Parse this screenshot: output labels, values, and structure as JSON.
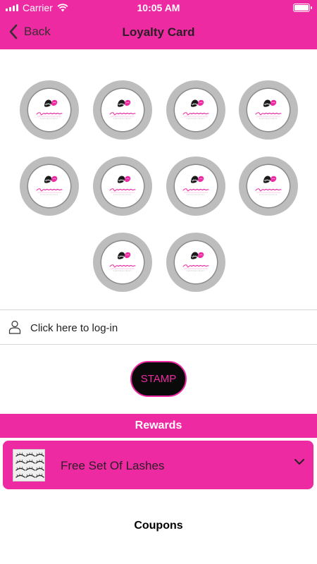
{
  "status_bar": {
    "carrier": "Carrier",
    "time": "10:05 AM"
  },
  "nav": {
    "back_label": "Back",
    "title": "Loyalty Card"
  },
  "stamps": {
    "count": 10,
    "logo_alt": "Pretty Little Habits logo"
  },
  "login": {
    "label": "Click here to log-in"
  },
  "stamp_button": {
    "label": "STAMP"
  },
  "rewards": {
    "header": "Rewards",
    "items": [
      {
        "title": "Free Set Of Lashes",
        "thumb": "lashes-image"
      }
    ]
  },
  "coupons": {
    "header": "Coupons"
  },
  "colors": {
    "accent": "#ee2aa2",
    "stamp_ring": "#bdbdbd",
    "button_bg": "#0a0a0a"
  }
}
